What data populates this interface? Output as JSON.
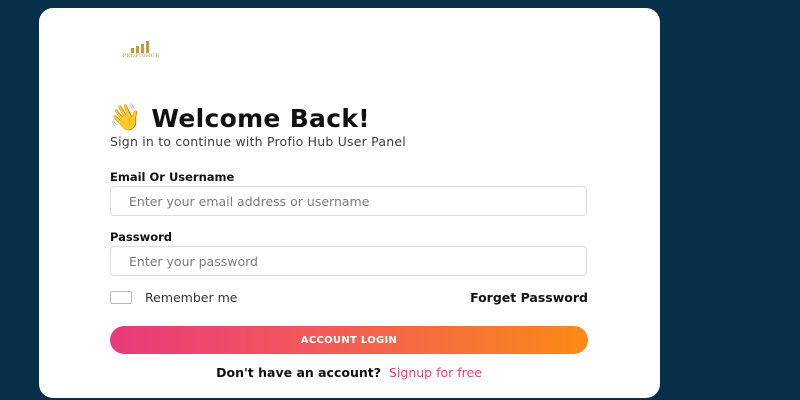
{
  "logo": {
    "brand_text": "PROFIOHUB",
    "icon": "bar-chart-logo-icon",
    "color": "#c59a3c"
  },
  "header": {
    "wave_icon": "👋",
    "title": "Welcome Back!",
    "subtitle": "Sign in to continue with Profio Hub User Panel"
  },
  "form": {
    "email": {
      "label": "Email Or Username",
      "placeholder": "Enter your email address or username",
      "value": ""
    },
    "password": {
      "label": "Password",
      "placeholder": "Enter your password",
      "value": ""
    },
    "remember_label": "Remember me",
    "remember_checked": false,
    "forget_label": "Forget Password",
    "submit_label": "ACCOUNT LOGIN"
  },
  "footer": {
    "prompt": "Don't have an account?",
    "signup_label": "Signup for free"
  },
  "colors": {
    "background": "#06304a",
    "card": "#ffffff",
    "gradient_start": "#e83a7c",
    "gradient_end": "#fb8a16",
    "link_accent": "#e8416f"
  }
}
